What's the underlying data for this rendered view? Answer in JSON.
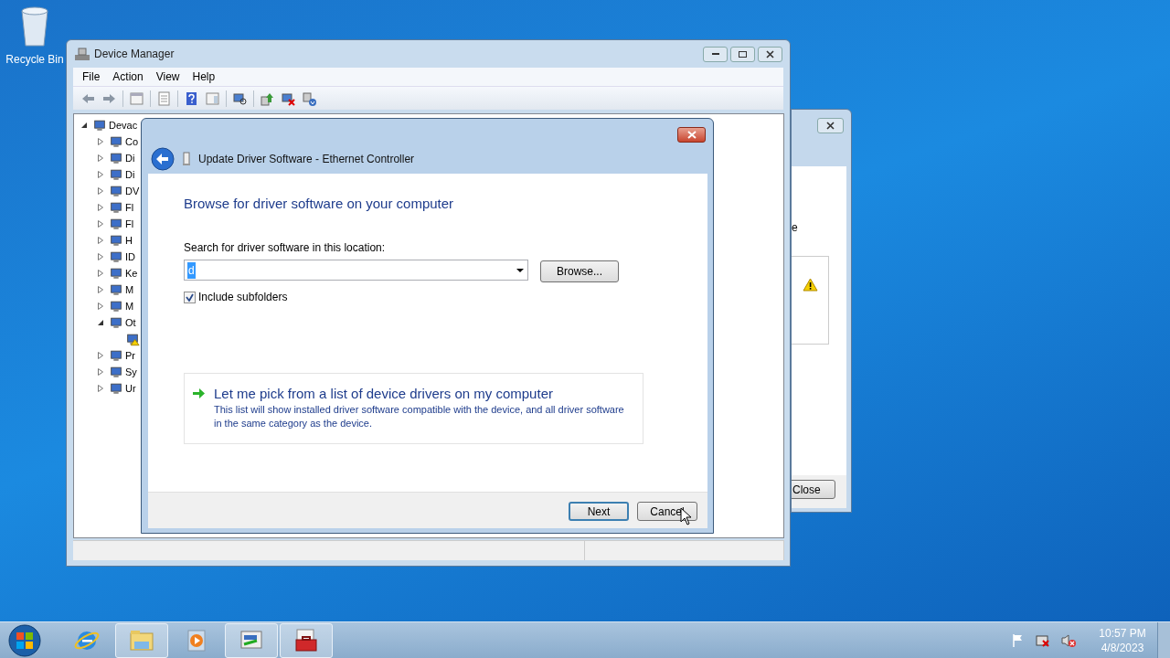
{
  "desktop": {
    "icons": [
      {
        "label": "Recycle Bin"
      }
    ]
  },
  "device_manager": {
    "title": "Device Manager",
    "menu": [
      "File",
      "Action",
      "View",
      "Help"
    ],
    "tree": [
      {
        "label": "Devac",
        "expanded": true,
        "children": [
          {
            "label": "Co",
            "expanded": false
          },
          {
            "label": "Di",
            "expanded": false
          },
          {
            "label": "Di",
            "expanded": false
          },
          {
            "label": "DV",
            "expanded": false
          },
          {
            "label": "Fl",
            "expanded": false
          },
          {
            "label": "Fl",
            "expanded": false
          },
          {
            "label": "H",
            "expanded": false
          },
          {
            "label": "ID",
            "expanded": false
          },
          {
            "label": "Ke",
            "expanded": false
          },
          {
            "label": "M",
            "expanded": false
          },
          {
            "label": "M",
            "expanded": false
          },
          {
            "label": "Ot",
            "expanded": true,
            "children": [
              {
                "warning": true
              }
            ]
          },
          {
            "label": "Pr",
            "expanded": false
          },
          {
            "label": "Sy",
            "expanded": false
          },
          {
            "label": "Ur",
            "expanded": false
          }
        ]
      }
    ]
  },
  "back_window": {
    "text_fragment": "e",
    "button": "Close"
  },
  "dialog": {
    "title": "Update Driver Software - Ethernet Controller",
    "heading": "Browse for driver software on your computer",
    "location_label": "Search for driver software in this location:",
    "location_value": "d",
    "browse_button": "Browse...",
    "include_subfolders": {
      "label": "Include subfolders",
      "checked": true
    },
    "pick_option": {
      "title": "Let me pick from a list of device drivers on my computer",
      "description": "This list will show installed driver software compatible with the device, and all driver software in the same category as the device."
    },
    "buttons": [
      {
        "label": "Next",
        "default": true
      },
      {
        "label": "Cancel",
        "default": false
      }
    ]
  },
  "taskbar": {
    "items": [
      {
        "kind": "ie",
        "open": false
      },
      {
        "kind": "explorer",
        "open": true
      },
      {
        "kind": "media",
        "open": false
      },
      {
        "kind": "network",
        "open": true
      },
      {
        "kind": "toolbox",
        "open": true
      }
    ],
    "clock": {
      "time": "10:57 PM",
      "date": "4/8/2023"
    }
  }
}
